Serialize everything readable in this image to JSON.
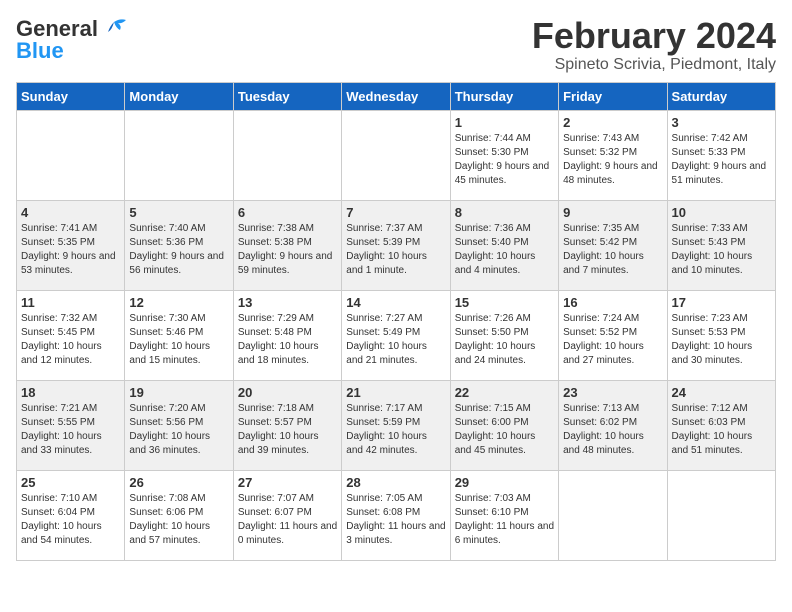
{
  "header": {
    "logo_general": "General",
    "logo_blue": "Blue",
    "title": "February 2024",
    "subtitle": "Spineto Scrivia, Piedmont, Italy"
  },
  "days_of_week": [
    "Sunday",
    "Monday",
    "Tuesday",
    "Wednesday",
    "Thursday",
    "Friday",
    "Saturday"
  ],
  "weeks": [
    [
      {
        "day": "",
        "info": ""
      },
      {
        "day": "",
        "info": ""
      },
      {
        "day": "",
        "info": ""
      },
      {
        "day": "",
        "info": ""
      },
      {
        "day": "1",
        "info": "Sunrise: 7:44 AM\nSunset: 5:30 PM\nDaylight: 9 hours\nand 45 minutes."
      },
      {
        "day": "2",
        "info": "Sunrise: 7:43 AM\nSunset: 5:32 PM\nDaylight: 9 hours\nand 48 minutes."
      },
      {
        "day": "3",
        "info": "Sunrise: 7:42 AM\nSunset: 5:33 PM\nDaylight: 9 hours\nand 51 minutes."
      }
    ],
    [
      {
        "day": "4",
        "info": "Sunrise: 7:41 AM\nSunset: 5:35 PM\nDaylight: 9 hours\nand 53 minutes."
      },
      {
        "day": "5",
        "info": "Sunrise: 7:40 AM\nSunset: 5:36 PM\nDaylight: 9 hours\nand 56 minutes."
      },
      {
        "day": "6",
        "info": "Sunrise: 7:38 AM\nSunset: 5:38 PM\nDaylight: 9 hours\nand 59 minutes."
      },
      {
        "day": "7",
        "info": "Sunrise: 7:37 AM\nSunset: 5:39 PM\nDaylight: 10 hours\nand 1 minute."
      },
      {
        "day": "8",
        "info": "Sunrise: 7:36 AM\nSunset: 5:40 PM\nDaylight: 10 hours\nand 4 minutes."
      },
      {
        "day": "9",
        "info": "Sunrise: 7:35 AM\nSunset: 5:42 PM\nDaylight: 10 hours\nand 7 minutes."
      },
      {
        "day": "10",
        "info": "Sunrise: 7:33 AM\nSunset: 5:43 PM\nDaylight: 10 hours\nand 10 minutes."
      }
    ],
    [
      {
        "day": "11",
        "info": "Sunrise: 7:32 AM\nSunset: 5:45 PM\nDaylight: 10 hours\nand 12 minutes."
      },
      {
        "day": "12",
        "info": "Sunrise: 7:30 AM\nSunset: 5:46 PM\nDaylight: 10 hours\nand 15 minutes."
      },
      {
        "day": "13",
        "info": "Sunrise: 7:29 AM\nSunset: 5:48 PM\nDaylight: 10 hours\nand 18 minutes."
      },
      {
        "day": "14",
        "info": "Sunrise: 7:27 AM\nSunset: 5:49 PM\nDaylight: 10 hours\nand 21 minutes."
      },
      {
        "day": "15",
        "info": "Sunrise: 7:26 AM\nSunset: 5:50 PM\nDaylight: 10 hours\nand 24 minutes."
      },
      {
        "day": "16",
        "info": "Sunrise: 7:24 AM\nSunset: 5:52 PM\nDaylight: 10 hours\nand 27 minutes."
      },
      {
        "day": "17",
        "info": "Sunrise: 7:23 AM\nSunset: 5:53 PM\nDaylight: 10 hours\nand 30 minutes."
      }
    ],
    [
      {
        "day": "18",
        "info": "Sunrise: 7:21 AM\nSunset: 5:55 PM\nDaylight: 10 hours\nand 33 minutes."
      },
      {
        "day": "19",
        "info": "Sunrise: 7:20 AM\nSunset: 5:56 PM\nDaylight: 10 hours\nand 36 minutes."
      },
      {
        "day": "20",
        "info": "Sunrise: 7:18 AM\nSunset: 5:57 PM\nDaylight: 10 hours\nand 39 minutes."
      },
      {
        "day": "21",
        "info": "Sunrise: 7:17 AM\nSunset: 5:59 PM\nDaylight: 10 hours\nand 42 minutes."
      },
      {
        "day": "22",
        "info": "Sunrise: 7:15 AM\nSunset: 6:00 PM\nDaylight: 10 hours\nand 45 minutes."
      },
      {
        "day": "23",
        "info": "Sunrise: 7:13 AM\nSunset: 6:02 PM\nDaylight: 10 hours\nand 48 minutes."
      },
      {
        "day": "24",
        "info": "Sunrise: 7:12 AM\nSunset: 6:03 PM\nDaylight: 10 hours\nand 51 minutes."
      }
    ],
    [
      {
        "day": "25",
        "info": "Sunrise: 7:10 AM\nSunset: 6:04 PM\nDaylight: 10 hours\nand 54 minutes."
      },
      {
        "day": "26",
        "info": "Sunrise: 7:08 AM\nSunset: 6:06 PM\nDaylight: 10 hours\nand 57 minutes."
      },
      {
        "day": "27",
        "info": "Sunrise: 7:07 AM\nSunset: 6:07 PM\nDaylight: 11 hours\nand 0 minutes."
      },
      {
        "day": "28",
        "info": "Sunrise: 7:05 AM\nSunset: 6:08 PM\nDaylight: 11 hours\nand 3 minutes."
      },
      {
        "day": "29",
        "info": "Sunrise: 7:03 AM\nSunset: 6:10 PM\nDaylight: 11 hours\nand 6 minutes."
      },
      {
        "day": "",
        "info": ""
      },
      {
        "day": "",
        "info": ""
      }
    ]
  ]
}
